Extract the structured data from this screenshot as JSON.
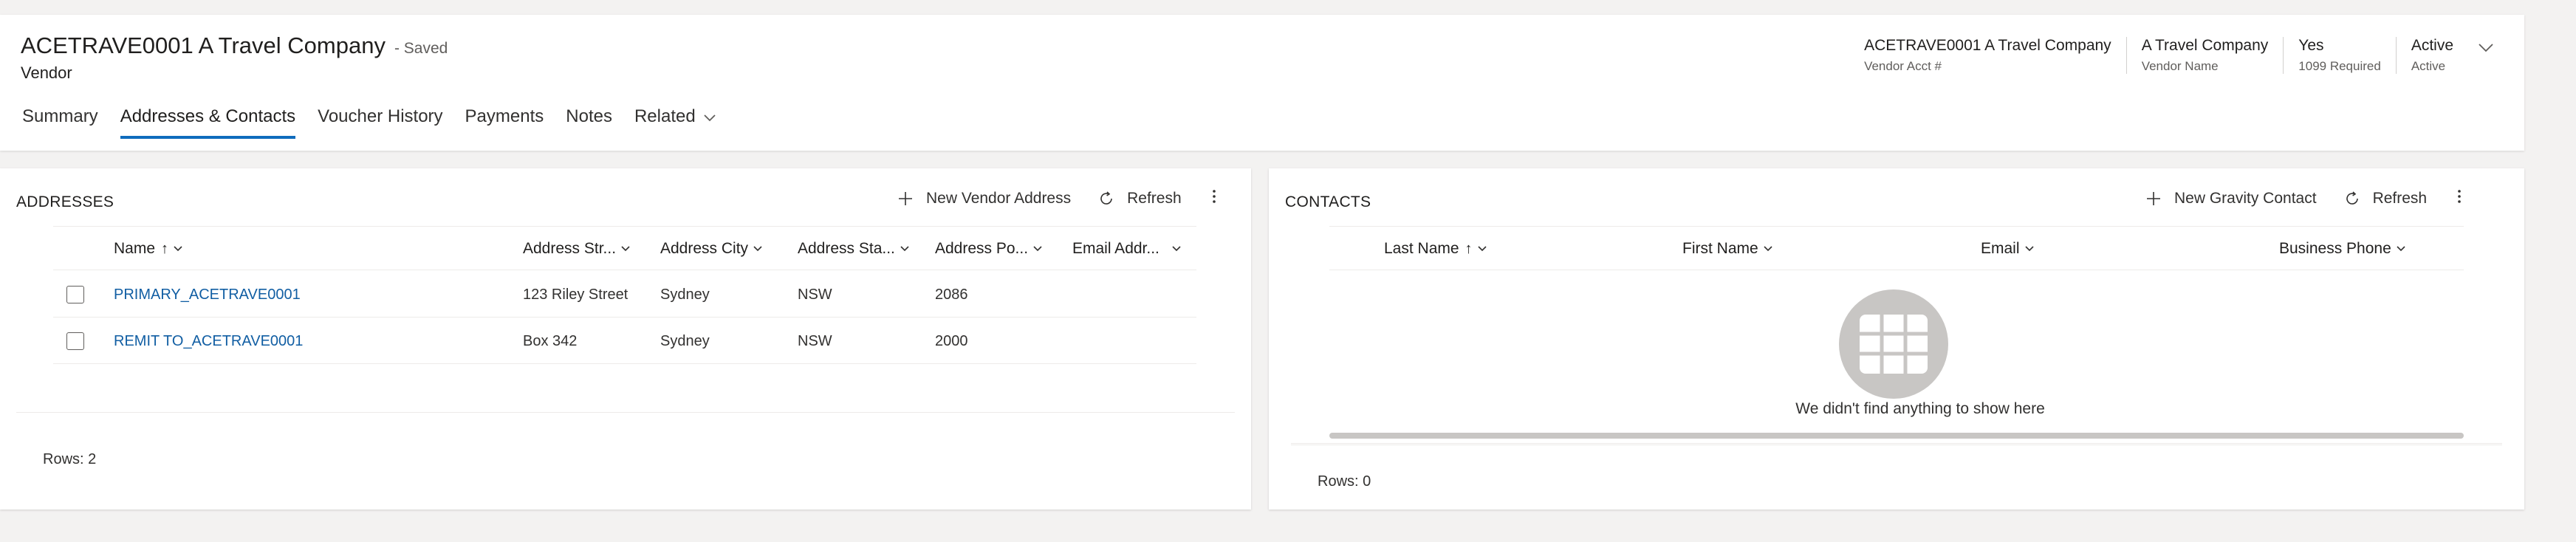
{
  "header": {
    "title": "ACETRAVE0001 A Travel Company",
    "saved_status": "- Saved",
    "entity_type": "Vendor",
    "summary": [
      {
        "value": "ACETRAVE0001 A Travel Company",
        "label": "Vendor Acct #"
      },
      {
        "value": "A Travel Company",
        "label": "Vendor Name"
      },
      {
        "value": "Yes",
        "label": "1099 Required"
      },
      {
        "value": "Active",
        "label": "Active"
      }
    ],
    "tabs": [
      "Summary",
      "Addresses & Contacts",
      "Voucher History",
      "Payments",
      "Notes",
      "Related"
    ],
    "active_tab": "Addresses & Contacts"
  },
  "addresses": {
    "title": "ADDRESSES",
    "new_label": "New Vendor Address",
    "refresh_label": "Refresh",
    "columns": [
      "Name",
      "Address Str...",
      "Address City",
      "Address Sta...",
      "Address Po...",
      "Email Addr..."
    ],
    "sort_arrow": "↑",
    "rows": [
      {
        "name": "PRIMARY_ACETRAVE0001",
        "street": "123 Riley Street",
        "city": "Sydney",
        "state": "NSW",
        "postal": "2086",
        "email": ""
      },
      {
        "name": "REMIT TO_ACETRAVE0001",
        "street": "Box 342",
        "city": "Sydney",
        "state": "NSW",
        "postal": "2000",
        "email": ""
      }
    ],
    "rows_count": "Rows: 2"
  },
  "contacts": {
    "title": "CONTACTS",
    "new_label": "New Gravity Contact",
    "refresh_label": "Refresh",
    "columns": [
      "Last Name",
      "First Name",
      "Email",
      "Business Phone"
    ],
    "sort_arrow": "↑",
    "empty_message": "We didn't find anything to show here",
    "rows_count": "Rows: 0"
  },
  "colors": {
    "accent": "#0f6cbd",
    "link": "#115ea3",
    "empty_icon": "#c8c6c4"
  },
  "icons": [
    "plus-icon",
    "refresh-icon",
    "more-vertical-icon",
    "chevron-down-icon",
    "grid-icon"
  ]
}
